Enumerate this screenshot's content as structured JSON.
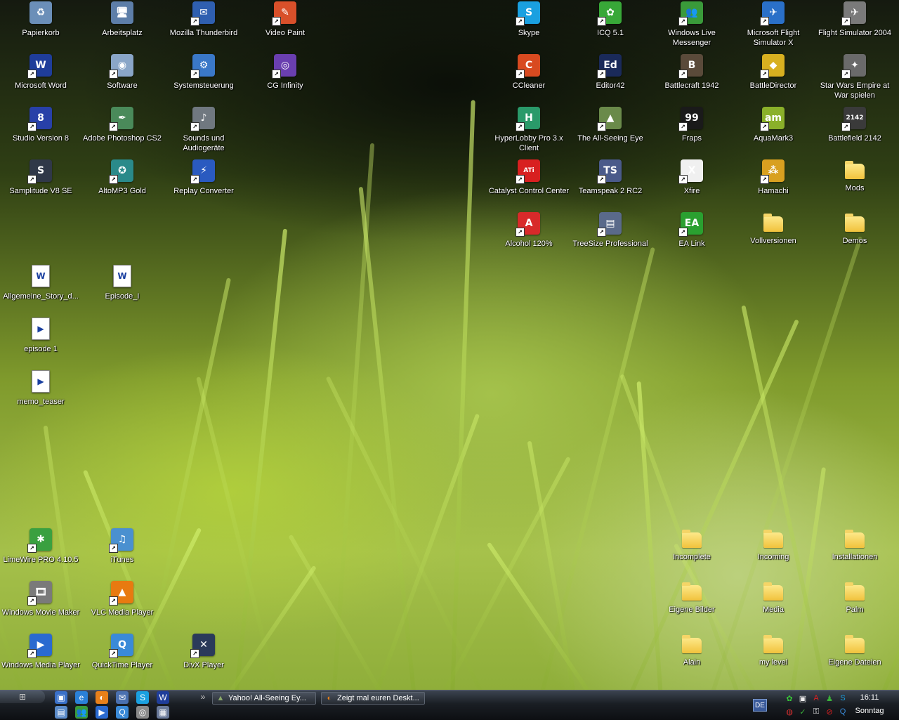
{
  "desktop_icons": [
    {
      "label": "Papierkorb",
      "glyph": "♻",
      "color": "#6b8fb8",
      "icon": "recycle-bin-icon",
      "shortcut": false
    },
    {
      "label": "Arbeitsplatz",
      "glyph": "🖥",
      "color": "#5d7ea8",
      "icon": "computer-icon",
      "shortcut": false
    },
    {
      "label": "Mozilla Thunderbird",
      "glyph": "✉",
      "color": "#2f5fb0",
      "icon": "thunderbird-icon",
      "shortcut": true
    },
    {
      "label": "Video Paint",
      "glyph": "✎",
      "color": "#d8502a",
      "icon": "video-paint-icon",
      "shortcut": true
    },
    {
      "label": "Microsoft Word",
      "glyph": "W",
      "color": "#1f3d9a",
      "icon": "word-icon",
      "shortcut": true
    },
    {
      "label": "Software",
      "glyph": "◉",
      "color": "#8aa6c8",
      "icon": "software-icon",
      "shortcut": true
    },
    {
      "label": "Systemsteuerung",
      "glyph": "⚙",
      "color": "#3a78c8",
      "icon": "control-panel-icon",
      "shortcut": true
    },
    {
      "label": "CG Infinity",
      "glyph": "◎",
      "color": "#6a3fb0",
      "icon": "cg-infinity-icon",
      "shortcut": true
    },
    {
      "label": "Studio Version 8",
      "glyph": "8",
      "color": "#2840a8",
      "icon": "studio-icon",
      "shortcut": true
    },
    {
      "label": "Adobe Photoshop CS2",
      "glyph": "✒",
      "color": "#4a8a5a",
      "icon": "photoshop-icon",
      "shortcut": true
    },
    {
      "label": "Sounds und Audiogeräte",
      "glyph": "♪",
      "color": "#707880",
      "icon": "sounds-icon",
      "shortcut": true
    },
    {
      "label": "Samplitude V8 SE",
      "glyph": "S",
      "color": "#303848",
      "icon": "samplitude-icon",
      "shortcut": true
    },
    {
      "label": "AltoMP3 Gold",
      "glyph": "✪",
      "color": "#2a8a8a",
      "icon": "altomp3-icon",
      "shortcut": true
    },
    {
      "label": "Replay Converter",
      "glyph": "⚡",
      "color": "#2a5ac0",
      "icon": "replay-converter-icon",
      "shortcut": true
    },
    {
      "label": "Allgemeine_Story_d...",
      "glyph": "W",
      "color": "#ffffff",
      "icon": "word-document-icon",
      "doc": true
    },
    {
      "label": "Episode_I",
      "glyph": "W",
      "color": "#ffffff",
      "icon": "word-document-icon",
      "doc": true
    },
    {
      "label": "episode 1",
      "glyph": "▶",
      "color": "#ffffff",
      "icon": "wmv-file-icon",
      "doc": true
    },
    {
      "label": "memo_teaser",
      "glyph": "▶",
      "color": "#ffffff",
      "icon": "wmv-file-icon",
      "doc": true
    },
    {
      "label": "LimeWire PRO 4.10.5",
      "glyph": "✱",
      "color": "#3aa040",
      "icon": "limewire-icon",
      "shortcut": true
    },
    {
      "label": "iTunes",
      "glyph": "♫",
      "color": "#4a90d0",
      "icon": "itunes-icon",
      "shortcut": true
    },
    {
      "label": "Windows Movie Maker",
      "glyph": "🎞",
      "color": "#7a7a7a",
      "icon": "movie-maker-icon",
      "shortcut": true
    },
    {
      "label": "VLC Media Player",
      "glyph": "▲",
      "color": "#e87a10",
      "icon": "vlc-icon",
      "shortcut": true
    },
    {
      "label": "Windows Media Player",
      "glyph": "▶",
      "color": "#2a6ad0",
      "icon": "media-player-icon",
      "shortcut": true
    },
    {
      "label": "QuickTime Player",
      "glyph": "Q",
      "color": "#3a8ad8",
      "icon": "quicktime-icon",
      "shortcut": true
    },
    {
      "label": "DivX Player",
      "glyph": "✕",
      "color": "#2a3a5a",
      "icon": "divx-icon",
      "shortcut": true
    },
    {
      "label": "Skype",
      "glyph": "S",
      "color": "#1aa0e0",
      "icon": "skype-icon",
      "shortcut": true
    },
    {
      "label": "ICQ 5.1",
      "glyph": "✿",
      "color": "#38a838",
      "icon": "icq-icon",
      "shortcut": true
    },
    {
      "label": "Windows Live Messenger",
      "glyph": "👥",
      "color": "#3a9a3a",
      "icon": "messenger-icon",
      "shortcut": true
    },
    {
      "label": "Microsoft Flight Simulator X",
      "glyph": "✈",
      "color": "#2a70c8",
      "icon": "flight-sim-x-icon",
      "shortcut": true
    },
    {
      "label": "Flight Simulator 2004",
      "glyph": "✈",
      "color": "#7a7a7a",
      "icon": "flight-sim-2004-icon",
      "shortcut": true
    },
    {
      "label": "CCleaner",
      "glyph": "C",
      "color": "#d84a20",
      "icon": "ccleaner-icon",
      "shortcut": true
    },
    {
      "label": "Editor42",
      "glyph": "Ed",
      "color": "#1a2a5a",
      "icon": "editor42-icon",
      "shortcut": true
    },
    {
      "label": "Battlecraft 1942",
      "glyph": "B",
      "color": "#5a4a3a",
      "icon": "battlecraft-icon",
      "shortcut": true
    },
    {
      "label": "BattleDirector",
      "glyph": "◆",
      "color": "#d8b020",
      "icon": "battledirector-icon",
      "shortcut": true
    },
    {
      "label": "Star Wars Empire at War spielen",
      "glyph": "✦",
      "color": "#6a6a6a",
      "icon": "star-wars-icon",
      "shortcut": true
    },
    {
      "label": "HyperLobby Pro 3.x Client",
      "glyph": "H",
      "color": "#2a9a6a",
      "icon": "hyperlobby-icon",
      "shortcut": true
    },
    {
      "label": "The All-Seeing Eye",
      "glyph": "▲",
      "color": "#6a8a4a",
      "icon": "all-seeing-eye-icon",
      "shortcut": true
    },
    {
      "label": "Fraps",
      "glyph": "99",
      "color": "#1a1a1a",
      "icon": "fraps-icon",
      "shortcut": true
    },
    {
      "label": "AquaMark3",
      "glyph": "am",
      "color": "#8ab02a",
      "icon": "aquamark-icon",
      "shortcut": true
    },
    {
      "label": "Battlefield 2142",
      "glyph": "2142",
      "color": "#3a3a3a",
      "icon": "battlefield-icon",
      "shortcut": true
    },
    {
      "label": "Catalyst Control Center",
      "glyph": "ATi",
      "color": "#d82020",
      "icon": "ati-icon",
      "shortcut": true
    },
    {
      "label": "Teamspeak 2 RC2",
      "glyph": "TS",
      "color": "#4a5a8a",
      "icon": "teamspeak-icon",
      "shortcut": true
    },
    {
      "label": "Xfire",
      "glyph": "X",
      "color": "#f0f0f0",
      "icon": "xfire-icon",
      "shortcut": true
    },
    {
      "label": "Hamachi",
      "glyph": "⁂",
      "color": "#d8a020",
      "icon": "hamachi-icon",
      "shortcut": true
    },
    {
      "label": "Mods",
      "icon": "folder-icon",
      "folder": true
    },
    {
      "label": "Alcohol 120%",
      "glyph": "A",
      "color": "#d82a2a",
      "icon": "alcohol-icon",
      "shortcut": true
    },
    {
      "label": "TreeSize Professional",
      "glyph": "▤",
      "color": "#5a6a8a",
      "icon": "treesize-icon",
      "shortcut": true
    },
    {
      "label": "EA Link",
      "glyph": "EA",
      "color": "#2aa030",
      "icon": "ea-link-icon",
      "shortcut": true
    },
    {
      "label": "Vollversionen",
      "icon": "folder-icon",
      "folder": true
    },
    {
      "label": "Demos",
      "icon": "folder-icon",
      "folder": true
    },
    {
      "label": "Incomplete",
      "icon": "folder-icon",
      "folder": true
    },
    {
      "label": "Incoming",
      "icon": "folder-icon",
      "folder": true
    },
    {
      "label": "Installationen",
      "icon": "folder-icon",
      "folder": true
    },
    {
      "label": "Eigene Bilder",
      "icon": "folder-icon",
      "folder": true
    },
    {
      "label": "Media",
      "icon": "folder-icon",
      "folder": true
    },
    {
      "label": "Palm",
      "icon": "folder-icon",
      "folder": true
    },
    {
      "label": "Alain",
      "icon": "folder-icon",
      "folder": true
    },
    {
      "label": "my level",
      "icon": "folder-icon",
      "folder": true
    },
    {
      "label": "Eigene Dateien",
      "icon": "folder-icon",
      "folder": true
    }
  ],
  "taskbar": {
    "start_glyph": "⊞",
    "quicklaunch_row1": [
      {
        "glyph": "▣",
        "color": "#3a70c8",
        "icon": "show-desktop-icon"
      },
      {
        "glyph": "e",
        "color": "#2a80d8",
        "icon": "internet-explorer-icon"
      },
      {
        "glyph": "◐",
        "color": "#e8801a",
        "icon": "firefox-icon"
      },
      {
        "glyph": "✉",
        "color": "#4a70b0",
        "icon": "thunderbird-icon"
      },
      {
        "glyph": "S",
        "color": "#1aa0e0",
        "icon": "skype-icon"
      },
      {
        "glyph": "W",
        "color": "#1f3d9a",
        "icon": "word-icon"
      }
    ],
    "quicklaunch_row2": [
      {
        "glyph": "▤",
        "color": "#5a8ac8",
        "icon": "explorer-icon"
      },
      {
        "glyph": "👥",
        "color": "#3a9a3a",
        "icon": "messenger-icon"
      },
      {
        "glyph": "▶",
        "color": "#2a6ad0",
        "icon": "media-player-icon"
      },
      {
        "glyph": "Q",
        "color": "#3a8ad8",
        "icon": "quicktime-icon"
      },
      {
        "glyph": "◎",
        "color": "#8a8a8a",
        "icon": "search-icon"
      },
      {
        "glyph": "▦",
        "color": "#6a7a9a",
        "icon": "calculator-icon"
      }
    ],
    "chevron": "»",
    "tasks": [
      {
        "label": "Yahoo! All-Seeing Ey...",
        "glyph": "▲",
        "color": "#8aa86a",
        "icon": "all-seeing-eye-icon"
      },
      {
        "label": "Zeigt mal euren Deskt...",
        "glyph": "◐",
        "color": "#e8801a",
        "icon": "firefox-icon"
      }
    ],
    "language": "DE",
    "tray_row1": [
      {
        "glyph": "✿",
        "color": "#38c838",
        "icon": "icq-tray-icon"
      },
      {
        "glyph": "▣",
        "color": "#f0f0f0",
        "icon": "network-tray-icon"
      },
      {
        "glyph": "A",
        "color": "#e02020",
        "icon": "ati-tray-icon"
      },
      {
        "glyph": "♟",
        "color": "#3ab03a",
        "icon": "messenger-tray-icon"
      },
      {
        "glyph": "S",
        "color": "#1aa0e0",
        "icon": "skype-tray-icon"
      }
    ],
    "tray_row2": [
      {
        "glyph": "◍",
        "color": "#d83030",
        "icon": "antivirus-tray-icon"
      },
      {
        "glyph": "✓",
        "color": "#3ab03a",
        "icon": "update-tray-icon"
      },
      {
        "glyph": "⚿",
        "color": "#f0f0f0",
        "icon": "security-tray-icon"
      },
      {
        "glyph": "⊘",
        "color": "#e02020",
        "icon": "alcohol-tray-icon"
      },
      {
        "glyph": "Q",
        "color": "#3a8ad8",
        "icon": "quicktime-tray-icon"
      }
    ],
    "clock_time": "16:11",
    "clock_day": "Sonntag"
  }
}
